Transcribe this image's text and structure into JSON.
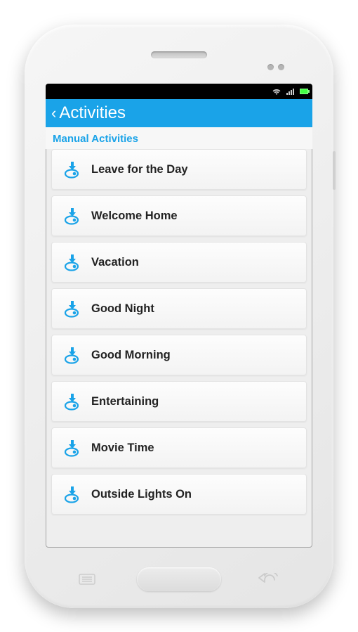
{
  "header": {
    "title": "Activities"
  },
  "section": {
    "title": "Manual Activities"
  },
  "activities": [
    {
      "label": "Leave for the Day"
    },
    {
      "label": "Welcome Home"
    },
    {
      "label": "Vacation"
    },
    {
      "label": "Good Night"
    },
    {
      "label": "Good Morning"
    },
    {
      "label": "Entertaining"
    },
    {
      "label": "Movie Time"
    },
    {
      "label": "Outside Lights On"
    }
  ]
}
